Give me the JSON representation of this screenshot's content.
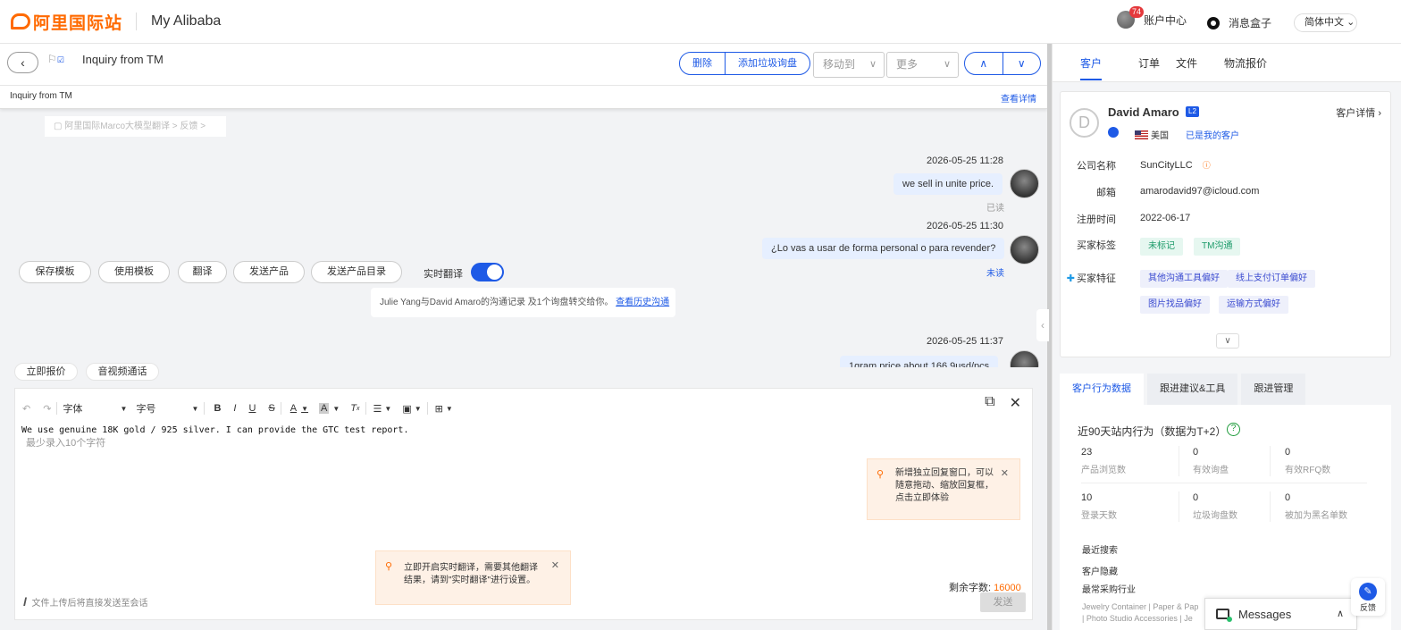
{
  "header": {
    "logo_text": "阿里国际站",
    "my_alibaba": "My Alibaba",
    "notification_count": "74",
    "account_center": "账户中心",
    "message_box": "消息盒子",
    "language": "简体中文"
  },
  "inquiry": {
    "title": "Inquiry from TM",
    "delete_label": "删除",
    "spam_label": "添加垃圾询盘",
    "move_to_placeholder": "移动到",
    "more_placeholder": "更多",
    "sub_title": "Inquiry from TM",
    "view_details": "查看详情",
    "translate_hint": "阿里国际Marco大模型翻译 >    反馈 >"
  },
  "chat": {
    "messages": [
      {
        "time": "2026-05-25 11:28",
        "text": "we sell in unite price.",
        "status": "已读"
      },
      {
        "time": "2026-05-25 11:30",
        "text": "¿Lo vas a usar de forma personal o para revender?",
        "status": "未读"
      },
      {
        "time": "2026-05-25 11:37",
        "text": "1gram price about 166.9usd/pcs"
      }
    ],
    "system_note": "Julie Yang与David Amaro的沟通记录 及1个询盘转交给你。",
    "system_note_link": "查看历史沟通",
    "quick_quote": "立即报价",
    "video_call": "音视频通话"
  },
  "editor": {
    "font_label": "字体",
    "size_label": "字号",
    "text": "We use genuine 18K gold / 925 silver. I can provide the GTC test report.",
    "placeholder": "最少录入10个字符",
    "tip1": "新增独立回复窗口，可以随意拖动、缩放回复框，点击立即体验",
    "tip2": "立即开启实时翻译，需要其他翻译结果，请到\"实时翻译\"进行设置。",
    "remaining_label": "剩余字数:",
    "remaining_count": "16000",
    "save_template": "保存模板",
    "use_template": "使用模板",
    "translate": "翻译",
    "send_product": "发送产品",
    "send_catalog": "发送产品目录",
    "realtime_translate": "实时翻译",
    "upload_hint": "文件上传后将直接发送至会话",
    "send": "发送"
  },
  "right_panel": {
    "tabs": [
      "客户",
      "订单",
      "文件",
      "物流报价"
    ],
    "customer": {
      "avatar_letter": "D",
      "name": "David Amaro",
      "level": "L2",
      "detail_link": "客户详情",
      "country": "美国",
      "is_my_customer": "已是我的客户",
      "company_label": "公司名称",
      "company": "SunCityLLC",
      "email_label": "邮箱",
      "email": "amarodavid97@icloud.com",
      "reg_label": "注册时间",
      "reg_date": "2022-06-17",
      "tags_label": "买家标签",
      "tags": [
        "未标记",
        "TM沟通"
      ],
      "features_label": "买家特征",
      "features": [
        "其他沟通工具偏好",
        "线上支付订单偏好",
        "图片找品偏好",
        "运输方式偏好"
      ]
    },
    "tabs2": [
      "客户行为数据",
      "跟进建议&工具",
      "跟进管理"
    ],
    "behavior": {
      "title": "近90天站内行为（数据为T+2）",
      "stats": [
        {
          "value": "23",
          "label": "产品浏览数"
        },
        {
          "value": "0",
          "label": "有效询盘"
        },
        {
          "value": "0",
          "label": "有效RFQ数"
        },
        {
          "value": "10",
          "label": "登录天数"
        },
        {
          "value": "0",
          "label": "垃圾询盘数"
        },
        {
          "value": "0",
          "label": "被加为黑名单数"
        }
      ],
      "recent_search": "最近搜索",
      "hidden_customer": "客户隐藏",
      "frequent_industry": "最常采购行业",
      "industry_line1": "Jewelry Container | Paper & Pap",
      "industry_line2": "| Photo Studio Accessories | Je"
    }
  },
  "messages_widget": {
    "label": "Messages"
  },
  "feedback": {
    "label": "反馈"
  },
  "colors": {
    "brand": "#ff6a00",
    "accent": "#1e5ae6",
    "bubble": "#e6efff"
  }
}
